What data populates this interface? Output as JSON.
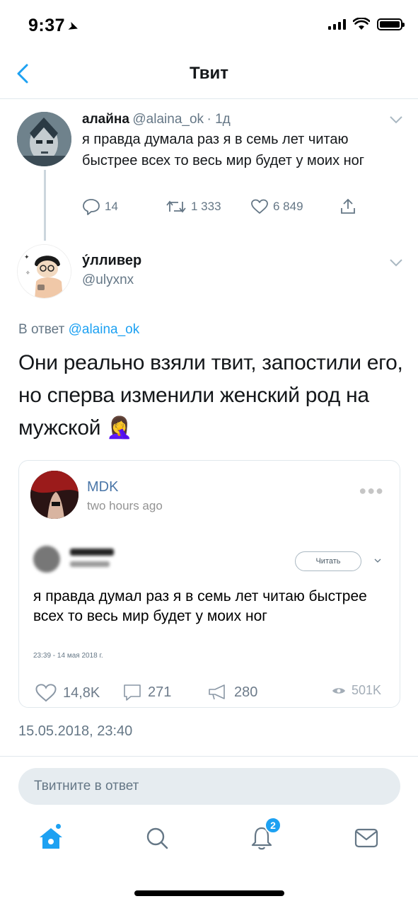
{
  "status_bar": {
    "time": "9:37"
  },
  "nav": {
    "title": "Твит"
  },
  "parent_tweet": {
    "name": "алайна",
    "handle": "@alaina_ok",
    "time": "· 1д",
    "text": "я правда думала раз я в семь лет читаю быстрее всех то весь мир будет у моих ног",
    "replies": "14",
    "retweets": "1 333",
    "likes": "6 849"
  },
  "reply_tweet": {
    "name": "у́лливер",
    "handle": "@ulyxnx",
    "reply_to_prefix": "В ответ",
    "reply_to_handle": "@alaina_ok",
    "text": "Они реально взяли твит, запостили его, но сперва изменили женский род на мужской 🤦‍♀️",
    "timestamp": "15.05.2018, 23:40"
  },
  "embedded_post": {
    "author": "MDK",
    "time": "two hours ago",
    "follow_label": "Читать",
    "tweet_text": "я правда думал раз я в семь лет читаю быстрее всех то весь мир будет у моих ног",
    "tweet_date": "23:39 - 14 мая 2018 г.",
    "likes": "14,8K",
    "comments": "271",
    "reposts": "280",
    "views": "501K"
  },
  "reply_box": {
    "placeholder": "Твитните в ответ"
  },
  "tabbar": {
    "notifications_badge": "2"
  },
  "colors": {
    "accent": "#1da1f2",
    "secondary_text": "#657786",
    "vk_blue": "#4a76a8"
  },
  "icons": [
    "back-chevron-icon",
    "reply-icon",
    "retweet-icon",
    "like-icon",
    "share-icon",
    "home-icon",
    "search-icon",
    "notifications-icon",
    "messages-icon"
  ]
}
